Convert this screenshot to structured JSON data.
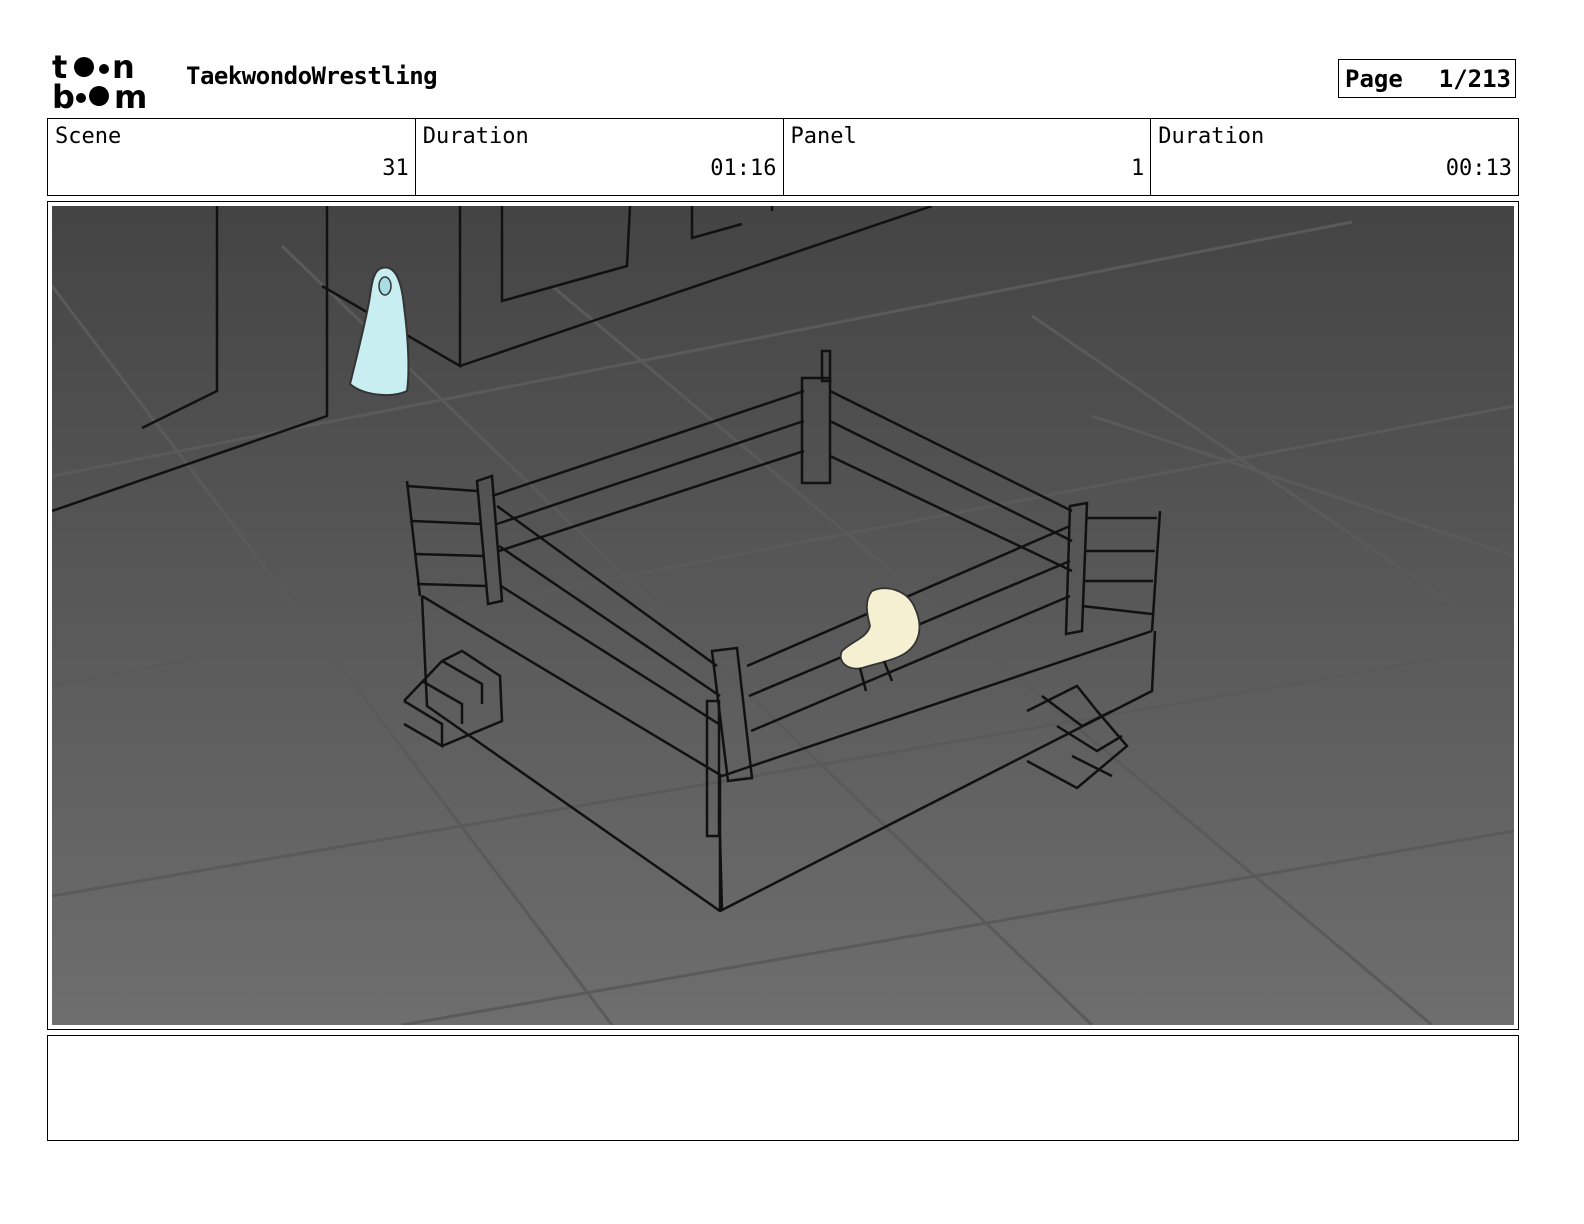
{
  "header": {
    "logo_line1": "toon",
    "logo_line2": "boom",
    "project_title": "TaekwondoWrestling",
    "page_label": "Page",
    "page_value": "1/213"
  },
  "info": {
    "scene_label": "Scene",
    "scene_value": "31",
    "scene_duration_label": "Duration",
    "scene_duration_value": "01:16",
    "panel_label": "Panel",
    "panel_value": "1",
    "panel_duration_label": "Duration",
    "panel_duration_value": "00:13"
  },
  "panel": {
    "image": "storyboard-sketch-wrestling-ring",
    "colors": {
      "bg_dark": "#444444",
      "bg_light": "#6e6e6e",
      "ghost_figure": "#c8eef2",
      "seated_figure": "#f6f0d2",
      "ink": "#111111"
    }
  },
  "notes": {
    "text": ""
  }
}
